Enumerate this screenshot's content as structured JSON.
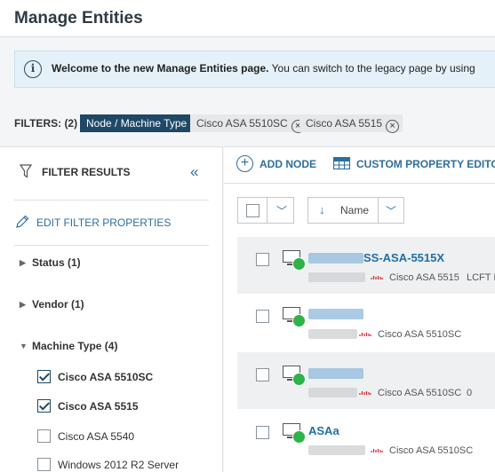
{
  "page": {
    "title": "Manage Entities"
  },
  "banner": {
    "bold_text": "Welcome to the new Manage Entities page.",
    "text": " You can switch to the legacy page by using"
  },
  "filters": {
    "label": "FILTERS: (2)",
    "type_chip": "Node / Machine Type",
    "chips": [
      "Cisco ASA 5510SC",
      "Cisco ASA 5515"
    ]
  },
  "sidebar": {
    "title": "FILTER RESULTS",
    "edit_label": "EDIT FILTER PROPERTIES",
    "groups": [
      {
        "label": "Status (1)",
        "expanded": false
      },
      {
        "label": "Vendor (1)",
        "expanded": false
      },
      {
        "label": "Machine Type (4)",
        "expanded": true
      }
    ],
    "machine_types": [
      {
        "label": "Cisco ASA 5510SC",
        "checked": true
      },
      {
        "label": "Cisco ASA 5515",
        "checked": true
      },
      {
        "label": "Cisco ASA 5540",
        "checked": false
      },
      {
        "label": "Windows 2012 R2 Server",
        "checked": false
      }
    ]
  },
  "toolbar": {
    "add_node": "ADD NODE",
    "custom_property": "CUSTOM PROPERTY EDITO"
  },
  "sort": {
    "label": "Name",
    "direction": "descending"
  },
  "rows": [
    {
      "name": "SS-ASA-5515X",
      "machine_type": "Cisco ASA 5515",
      "extra": "LCFT IT",
      "status": "up"
    },
    {
      "name": "",
      "machine_type": "Cisco ASA 5510SC",
      "extra": "",
      "status": "up"
    },
    {
      "name": "",
      "machine_type": "Cisco ASA 5510SC",
      "extra": "0",
      "status": "up"
    },
    {
      "name": "ASAa",
      "machine_type": "Cisco ASA 5510SC",
      "extra": "",
      "status": "up"
    }
  ],
  "colors": {
    "accent": "#2e6f9e",
    "chip_dark": "#1e4866",
    "status_up": "#2db34a",
    "banner_bg": "#e5f1f8"
  },
  "icons": {
    "info": "info-icon",
    "funnel": "funnel-icon",
    "collapse": "double-chevron-left-icon",
    "pencil": "pencil-icon",
    "add": "plus-circle-icon",
    "table": "table-icon",
    "node": "node-icon",
    "vendor": "cisco-logo-icon"
  }
}
